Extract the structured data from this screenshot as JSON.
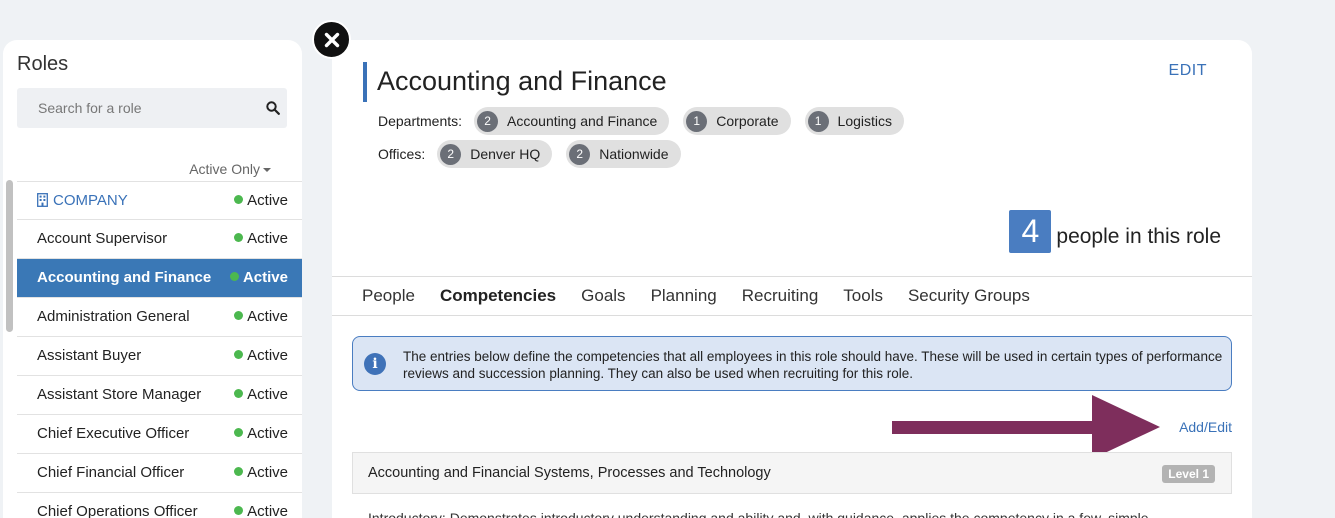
{
  "sidebar": {
    "title": "Roles",
    "search_placeholder": "Search for a role",
    "filter_label": "Active Only",
    "roles": [
      {
        "name": "COMPANY",
        "status": "Active"
      },
      {
        "name": "Account Supervisor",
        "status": "Active"
      },
      {
        "name": "Accounting and Finance",
        "status": "Active"
      },
      {
        "name": "Administration General",
        "status": "Active"
      },
      {
        "name": "Assistant Buyer",
        "status": "Active"
      },
      {
        "name": "Assistant Store Manager",
        "status": "Active"
      },
      {
        "name": "Chief Executive Officer",
        "status": "Active"
      },
      {
        "name": "Chief Financial Officer",
        "status": "Active"
      },
      {
        "name": "Chief Operations Officer",
        "status": "Active"
      }
    ]
  },
  "main": {
    "title": "Accounting and Finance",
    "edit_label": "EDIT",
    "departments_label": "Departments:",
    "departments": [
      {
        "count": "2",
        "name": "Accounting and Finance"
      },
      {
        "count": "1",
        "name": "Corporate"
      },
      {
        "count": "1",
        "name": "Logistics"
      }
    ],
    "offices_label": "Offices:",
    "offices": [
      {
        "count": "2",
        "name": "Denver HQ"
      },
      {
        "count": "2",
        "name": "Nationwide"
      }
    ],
    "people_count": "4",
    "people_text": "people in this role",
    "tabs": [
      "People",
      "Competencies",
      "Goals",
      "Planning",
      "Recruiting",
      "Tools",
      "Security Groups"
    ],
    "active_tab": "Competencies",
    "info_text": "The entries below define the competencies that all employees in this role should have. These will be used in certain types of performance reviews and succession planning. They can also be used when recruiting for this role.",
    "add_edit_label": "Add/Edit",
    "competency": {
      "name": "Accounting and Financial Systems, Processes and Technology",
      "level": "Level 1",
      "description": "Introductory: Demonstrates introductory understanding and ability and, with guidance, applies the competency in a few, simple"
    }
  },
  "colors": {
    "accent": "#3a72b8",
    "selected_row": "#3a78b6",
    "status_active": "#4cb84f",
    "annotation_arrow": "#7e2e5c"
  },
  "icons": [
    "search-icon",
    "building-icon",
    "close-icon",
    "info-icon",
    "arrow-annotation"
  ]
}
